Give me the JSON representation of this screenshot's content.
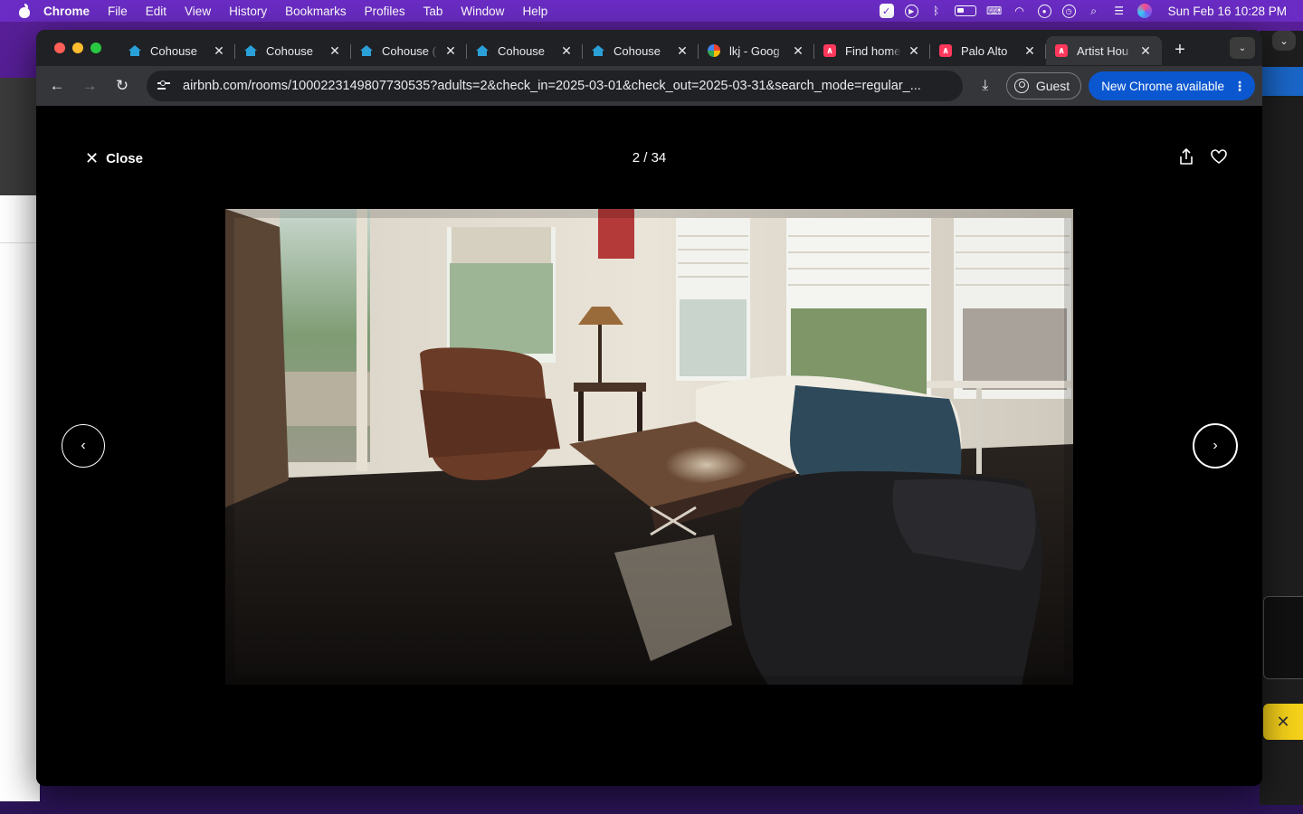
{
  "menubar": {
    "app": "Chrome",
    "menus": [
      "File",
      "Edit",
      "View",
      "History",
      "Bookmarks",
      "Profiles",
      "Tab",
      "Window",
      "Help"
    ],
    "clock": "Sun Feb 16  10:28 PM"
  },
  "tabs": [
    {
      "title": "Cohouse",
      "favicon": "house-icon"
    },
    {
      "title": "Cohouse",
      "favicon": "house-icon"
    },
    {
      "title": "Cohouse (",
      "favicon": "house-icon"
    },
    {
      "title": "Cohouse",
      "favicon": "house-icon"
    },
    {
      "title": "Cohouse",
      "favicon": "house-icon"
    },
    {
      "title": "lkj - Goog",
      "favicon": "google-icon"
    },
    {
      "title": "Find home",
      "favicon": "airbnb-icon"
    },
    {
      "title": "Palo Alto",
      "favicon": "airbnb-icon"
    },
    {
      "title": "Artist Hou",
      "favicon": "airbnb-icon",
      "active": true
    }
  ],
  "toolbar": {
    "url": "airbnb.com/rooms/1000223149807730535?adults=2&check_in=2025-03-01&check_out=2025-03-31&search_mode=regular_...",
    "guest_label": "Guest",
    "update_label": "New Chrome available"
  },
  "viewer": {
    "close_label": "Close",
    "counter": "2 / 34"
  },
  "colors": {
    "accent_update": "#0b57d0",
    "airbnb": "#ff385c",
    "menubar": "#6a2cc4"
  }
}
